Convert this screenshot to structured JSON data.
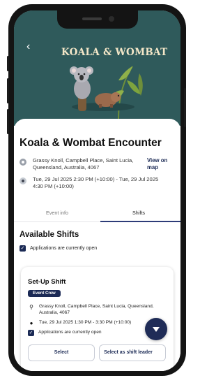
{
  "hero": {
    "back_icon": "chevron-left-icon",
    "brand_title": "KOALA & WOMBAT"
  },
  "event": {
    "title": "Koala & Wombat Encounter",
    "location": "Grassy Knoll, Campbell Place, Saint Lucia, Queensland, Australia, 4067",
    "view_map": "View on map",
    "datetime": "Tue, 29 Jul 2025 2:30 PM (+10:00) - Tue, 29 Jul 2025 4:30 PM (+10:00)"
  },
  "tabs": {
    "items": [
      {
        "label": "Event info",
        "active": false
      },
      {
        "label": "Shifts",
        "active": true
      }
    ]
  },
  "shifts": {
    "heading": "Available Shifts",
    "applications_open": "Applications are currently open",
    "card": {
      "title": "Set-Up Shift",
      "badge": "Event Crew",
      "location": "Grassy Knoll, Campbell Place, Saint Lucia, Queensland, Australia, 4067",
      "time": "Tue, 29 Jul 2025 1:30 PM - 3:30 PM (+10:00)",
      "applications_open": "Applications are currently open",
      "select_label": "Select",
      "select_leader_label": "Select as shift leader"
    }
  },
  "fab": {
    "icon": "chevron-down-icon"
  },
  "colors": {
    "primary": "#1b2a55",
    "hero_bg": "#2f5a5b"
  }
}
